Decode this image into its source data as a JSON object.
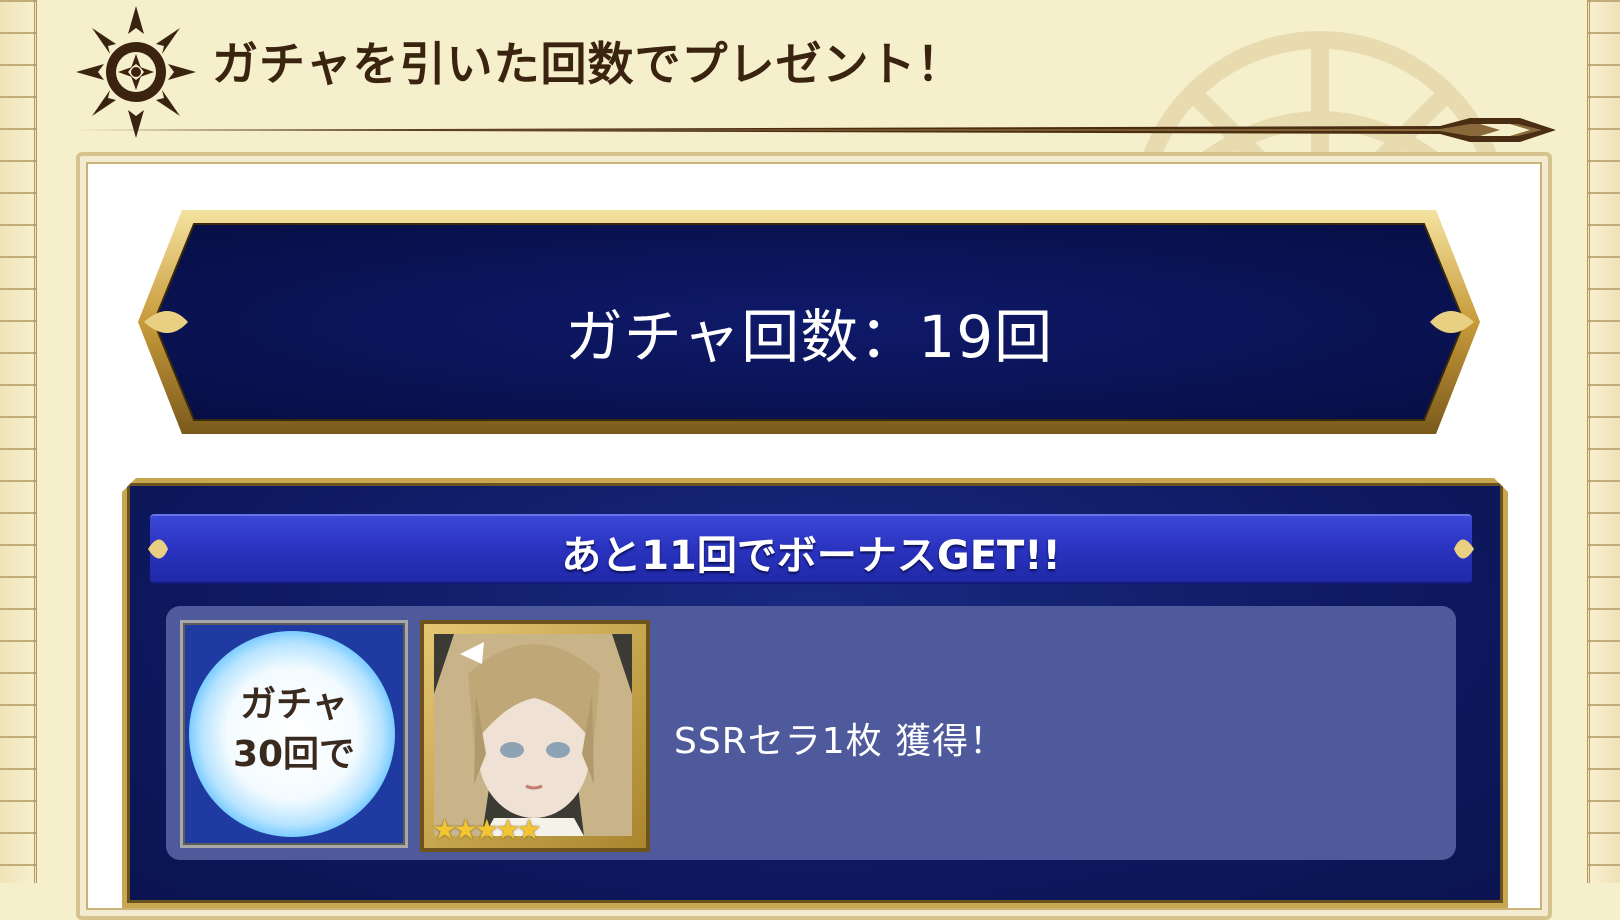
{
  "header": {
    "title": "ガチャを引いた回数でプレゼント！"
  },
  "counter": {
    "text": "ガチャ回数：19回",
    "count": 19
  },
  "bonus": {
    "banner_text": "あと11回でボーナスGET!!",
    "remaining": 11,
    "threshold_label_line1": "ガチャ",
    "threshold_label_line2": "30回で",
    "threshold": 30,
    "reward_text": "SSRセラ1枚 獲得！",
    "reward_rarity_stars": 5
  },
  "colors": {
    "parchment": "#f6efcc",
    "navy": "#0e1960",
    "gold": "#c9a650",
    "card": "#4e5a9c",
    "title_brown": "#3a2410"
  },
  "icons": {
    "header_emblem": "snowflake-emblem-icon",
    "orb": "gacha-orb-icon",
    "portrait": "character-portrait",
    "star": "rarity-star-icon"
  }
}
